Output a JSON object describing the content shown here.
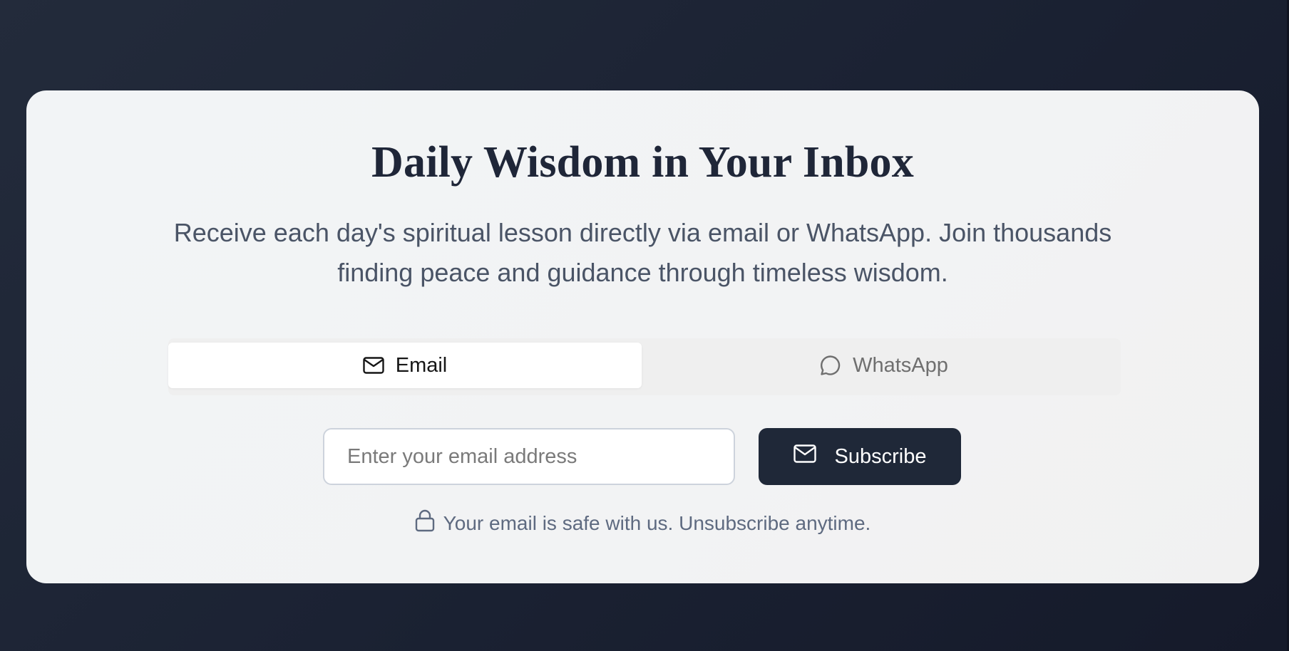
{
  "card": {
    "title": "Daily Wisdom in Your Inbox",
    "subtitle": "Receive each day's spiritual lesson directly via email or WhatsApp. Join thousands finding peace and guidance through timeless wisdom."
  },
  "tabs": {
    "items": [
      {
        "label": "Email",
        "icon": "mail-icon",
        "selected": true
      },
      {
        "label": "WhatsApp",
        "icon": "message-circle-icon",
        "selected": false
      }
    ]
  },
  "form": {
    "email_placeholder": "Enter your email address",
    "email_value": "",
    "subscribe_label": "Subscribe",
    "subscribe_icon": "mail-icon"
  },
  "note": {
    "text": "Your email is safe with us. Unsubscribe anytime.",
    "icon": "lock-icon"
  },
  "colors": {
    "background": "#1b2233",
    "card": "#f2f3f4",
    "title": "#1f2638",
    "button": "#1f2838",
    "note": "#5e6a80"
  }
}
